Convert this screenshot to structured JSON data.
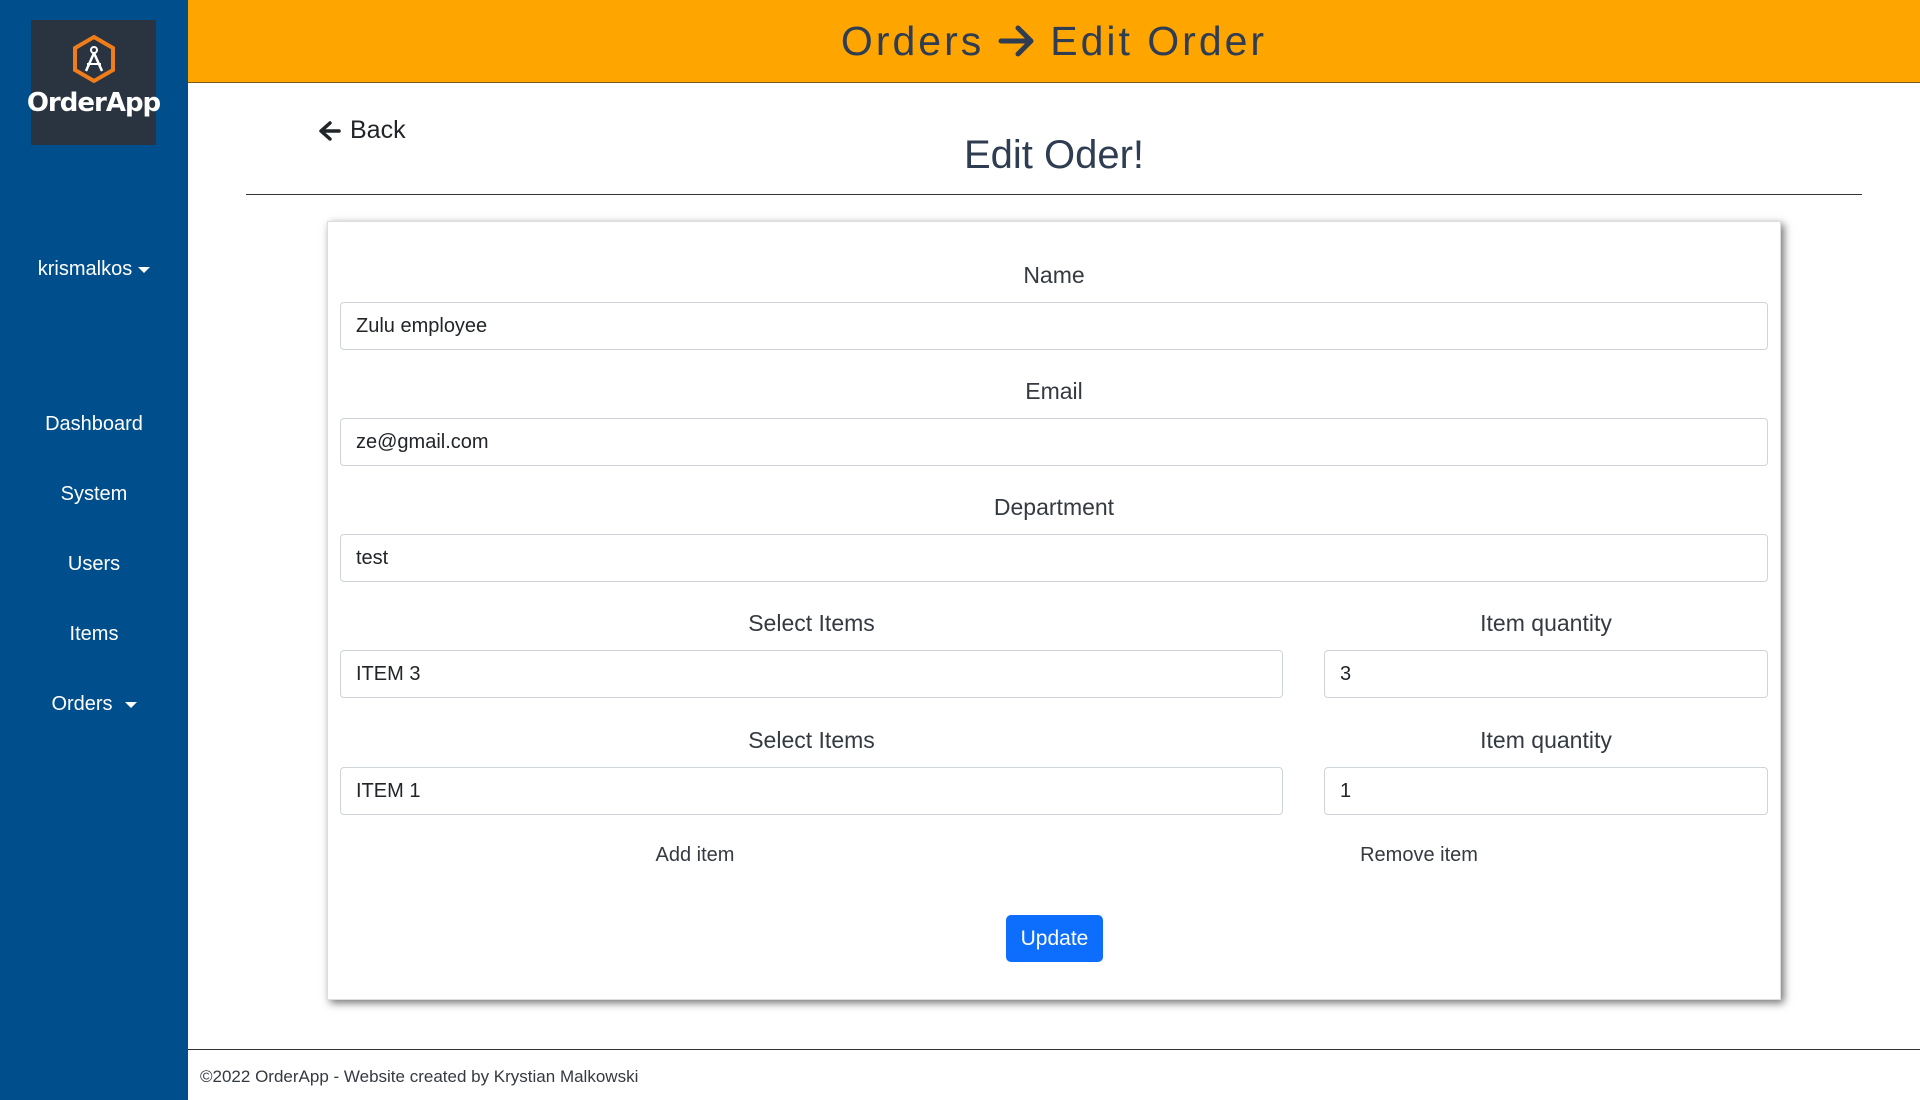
{
  "app": {
    "name": "OrderApp"
  },
  "header": {
    "crumb_parent": "Orders",
    "crumb_current": "Edit Order"
  },
  "sidebar": {
    "user": "krismalkos",
    "items": [
      {
        "label": "Dashboard"
      },
      {
        "label": "System"
      },
      {
        "label": "Users"
      },
      {
        "label": "Items"
      },
      {
        "label": "Orders"
      }
    ]
  },
  "main": {
    "back_label": "Back",
    "title": "Edit Oder!",
    "form": {
      "name_label": "Name",
      "name_value": "Zulu employee",
      "email_label": "Email",
      "email_value": "ze@gmail.com",
      "department_label": "Department",
      "department_value": "test",
      "rows": [
        {
          "item_label": "Select Items",
          "item_value": "ITEM 3",
          "qty_label": "Item quantity",
          "qty_value": "3"
        },
        {
          "item_label": "Select Items",
          "item_value": "ITEM 1",
          "qty_label": "Item quantity",
          "qty_value": "1"
        }
      ],
      "add_item": "Add item",
      "remove_item": "Remove item",
      "submit": "Update"
    }
  },
  "footer": {
    "text": "©2022 OrderApp - Website created by Krystian Malkowski"
  },
  "colors": {
    "sidebar": "#004e8c",
    "header": "#ffa500",
    "primary_button": "#0d6efd",
    "logo_bg": "#2a3440",
    "logo_accent": "#f07d1a"
  },
  "icons": {
    "logo": "compass-hexagon-icon",
    "back": "arrow-left-icon",
    "crumb": "arrow-right-icon",
    "dropdown": "caret-down-icon"
  }
}
